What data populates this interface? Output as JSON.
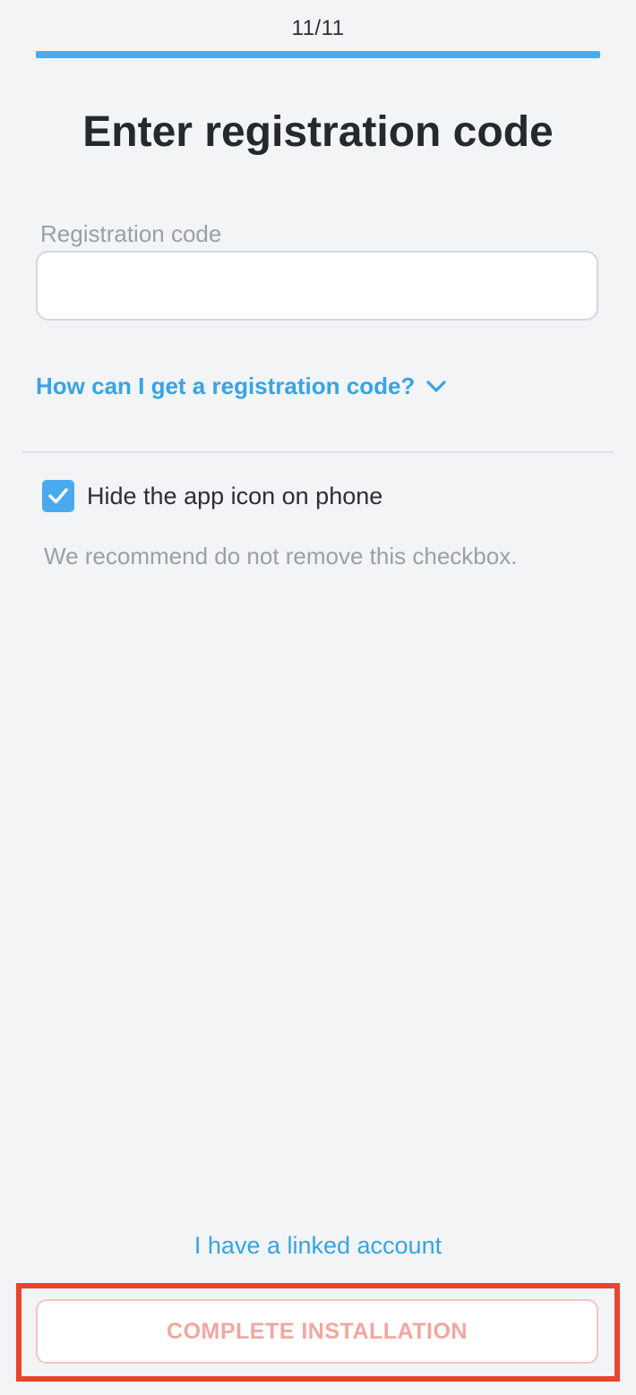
{
  "header": {
    "step_counter": "11/11",
    "progress_percent": 100
  },
  "main": {
    "title": "Enter registration code",
    "registration_field": {
      "label": "Registration code",
      "value": "",
      "placeholder": ""
    },
    "help_link_label": "How can I get a registration code?",
    "hide_icon_checkbox": {
      "label": "Hide the app icon on phone",
      "checked": true
    },
    "checkbox_hint": "We recommend do not remove this checkbox."
  },
  "footer": {
    "linked_account_label": "I have a linked account",
    "complete_button_label": "COMPLETE INSTALLATION"
  },
  "colors": {
    "accent": "#4aaaf0",
    "link": "#37a4e4",
    "highlight": "#e8452c",
    "button_text_disabled": "#f0a79f"
  },
  "icons": {
    "help_link": "chevron-down-icon",
    "checkbox": "checkmark-icon"
  }
}
